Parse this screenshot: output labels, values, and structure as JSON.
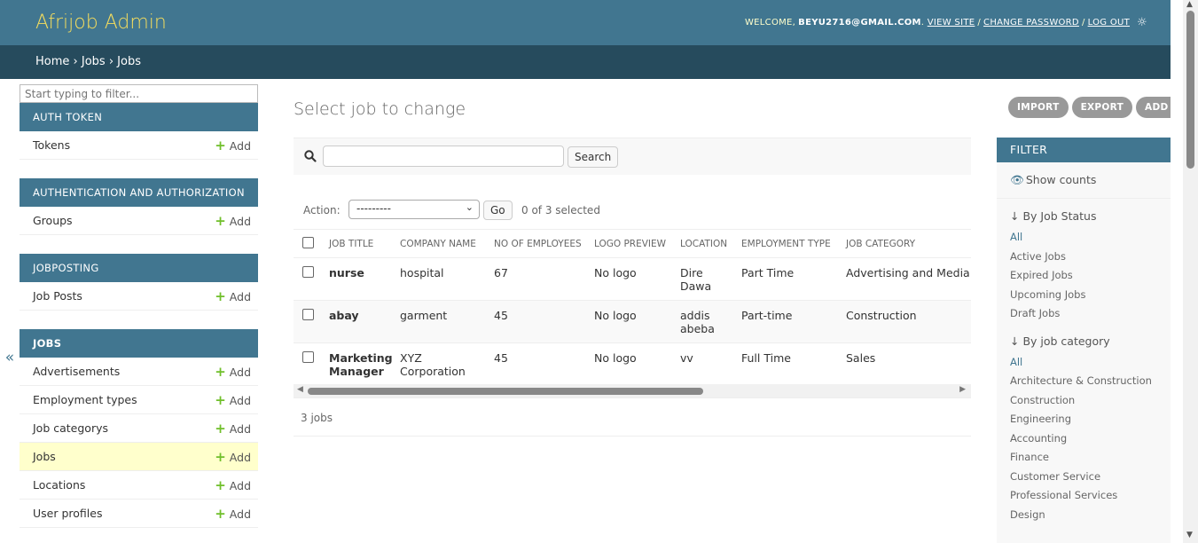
{
  "header": {
    "branding": "Afrijob Admin",
    "welcome": "WELCOME,",
    "username": "BEYU2716@GMAIL.COM",
    "view_site": "VIEW SITE",
    "change_password": "CHANGE PASSWORD",
    "log_out": "LOG OUT",
    "separator": "/",
    "theme_icon": "sun-icon"
  },
  "breadcrumbs": {
    "home": "Home",
    "app": "Jobs",
    "current": "Jobs",
    "separator": "›"
  },
  "sidebar": {
    "filter_placeholder": "Start typing to filter...",
    "add_label": "Add",
    "toggle": "«",
    "modules": [
      {
        "caption": "AUTH TOKEN",
        "rows": [
          "Tokens"
        ]
      },
      {
        "caption": "AUTHENTICATION AND AUTHORIZATION",
        "rows": [
          "Groups"
        ]
      },
      {
        "caption": "JOBPOSTING",
        "rows": [
          "Job Posts"
        ]
      },
      {
        "caption": "JOBS",
        "rows": [
          "Advertisements",
          "Employment types",
          "Job categorys",
          "Jobs",
          "Locations",
          "User profiles"
        ]
      }
    ]
  },
  "main": {
    "title": "Select job to change",
    "search_button": "Search",
    "action_label": "Action:",
    "action_selected": "---------",
    "go_button": "Go",
    "selected_count": "0 of 3 selected",
    "columns": [
      "JOB TITLE",
      "COMPANY NAME",
      "NO OF EMPLOYEES",
      "LOGO PREVIEW",
      "LOCATION",
      "EMPLOYMENT TYPE",
      "JOB CATEGORY"
    ],
    "rows": [
      [
        "nurse",
        "hospital",
        "67",
        "No logo",
        "Dire Dawa",
        "Part Time",
        "Advertising and Media"
      ],
      [
        "abay",
        "garment",
        "45",
        "No logo",
        "addis abeba",
        "Part-time",
        "Construction"
      ],
      [
        "Marketing Manager",
        "XYZ Corporation",
        "45",
        "No logo",
        "vv",
        "Full Time",
        "Sales"
      ]
    ],
    "paginator": "3 jobs"
  },
  "object_tools": [
    "IMPORT",
    "EXPORT",
    "ADD JOB"
  ],
  "filter": {
    "title": "FILTER",
    "show_counts": "Show counts",
    "groups": [
      {
        "heading": "↓ By Job Status",
        "items": [
          "All",
          "Active Jobs",
          "Expired Jobs",
          "Upcoming Jobs",
          "Draft Jobs"
        ]
      },
      {
        "heading": "↓ By job category",
        "items": [
          "All",
          "Architecture & Construction",
          "Construction",
          "Engineering",
          "Accounting",
          "Finance",
          "Customer Service",
          "Professional Services",
          "Design"
        ]
      }
    ]
  },
  "colors": {
    "header_bg": "#417690",
    "breadcrumb_bg": "#264b5d",
    "branding": "#f5dd5d",
    "add_plus": "#70bf2b",
    "current_row": "#ffffcc"
  }
}
